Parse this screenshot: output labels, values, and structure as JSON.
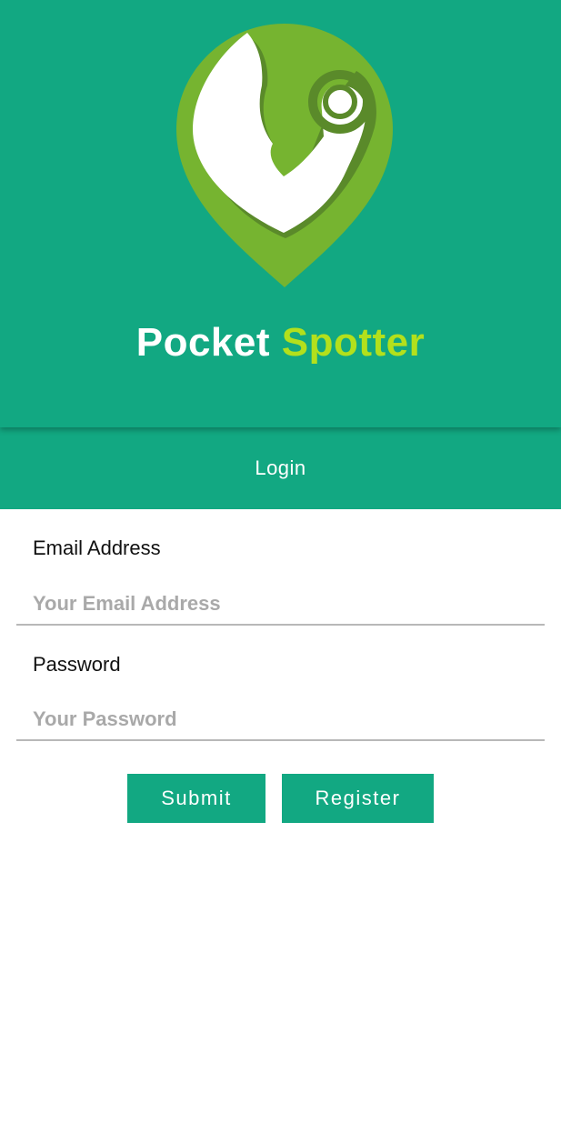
{
  "brand": {
    "name_part1": "Pocket",
    "name_part2": "Spotter",
    "logo_icon": "flexed-arm-map-pin-icon"
  },
  "colors": {
    "primary": "#12a882",
    "accent": "#b3e01c",
    "logo_green": "#76b430",
    "logo_dark_green": "#5a8a2a"
  },
  "tabs": [
    {
      "label": "Login"
    }
  ],
  "form": {
    "email": {
      "label": "Email Address",
      "placeholder": "Your Email Address",
      "value": ""
    },
    "password": {
      "label": "Password",
      "placeholder": "Your Password",
      "value": ""
    }
  },
  "buttons": {
    "submit": "Submit",
    "register": "Register"
  }
}
